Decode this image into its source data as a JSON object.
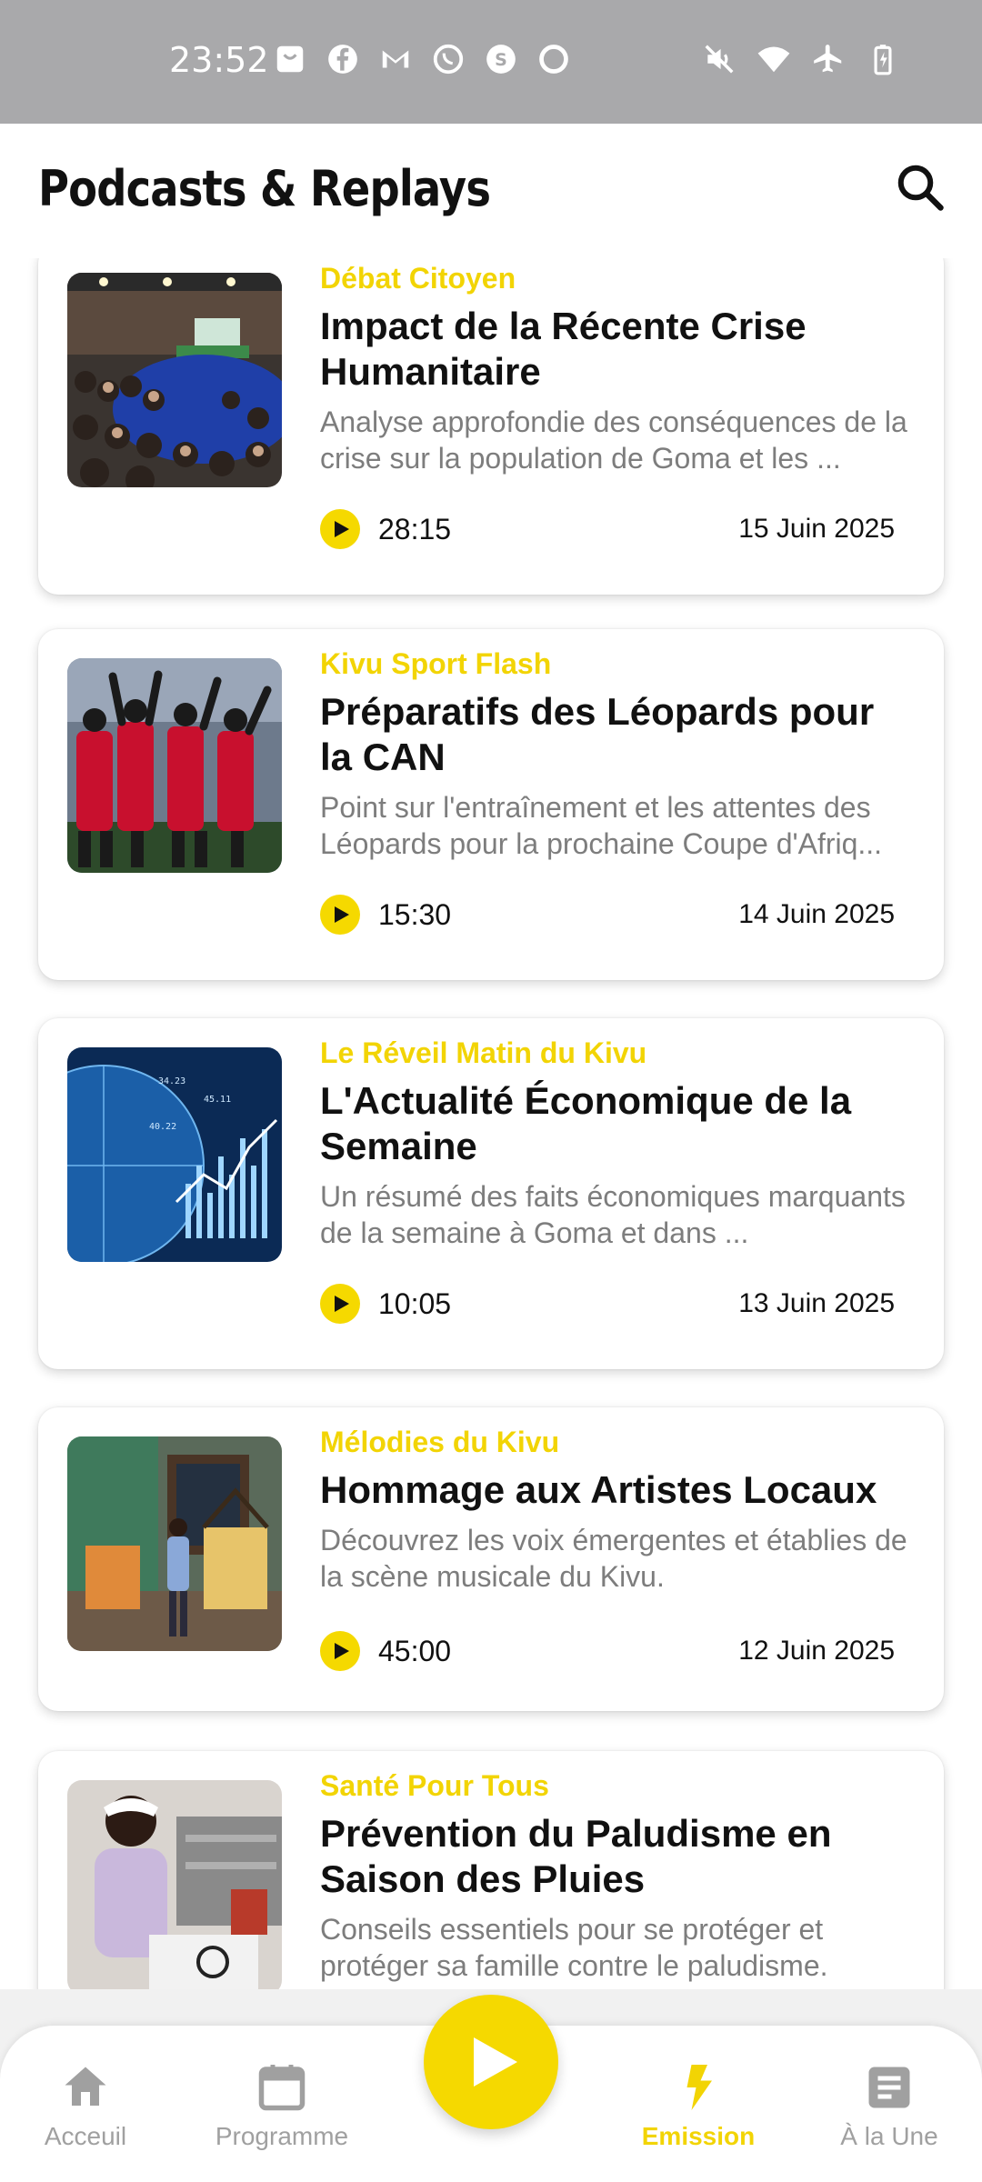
{
  "status_bar": {
    "time": "23:52",
    "left_icons": [
      "shopping-bag-icon",
      "facebook-icon",
      "gmail-icon",
      "whatsapp-icon",
      "shazam-icon",
      "circle-app-icon"
    ],
    "right_icons": [
      "mute-icon",
      "wifi-icon",
      "airplane-icon",
      "battery-charging-icon"
    ]
  },
  "header": {
    "title": "Podcasts & Replays",
    "search_icon": "search-icon"
  },
  "episodes": [
    {
      "category": "Débat Citoyen",
      "title": "Impact de la Récente Crise Humanitaire",
      "description": "Analyse approfondie des conséquences de la crise sur la population de Goma et les ...",
      "duration": "28:15",
      "date": "15 Juin 2025"
    },
    {
      "category": "Kivu Sport Flash",
      "title": "Préparatifs des Léopards pour la CAN",
      "description": "Point sur l'entraînement et les attentes des Léopards pour la prochaine Coupe d'Afriq...",
      "duration": "15:30",
      "date": "14 Juin 2025"
    },
    {
      "category": "Le Réveil Matin du Kivu",
      "title": "L'Actualité Économique de la Semaine",
      "description": "Un résumé des faits économiques marquants de la semaine à Goma et dans ...",
      "duration": "10:05",
      "date": "13 Juin 2025"
    },
    {
      "category": "Mélodies du Kivu",
      "title": "Hommage aux Artistes Locaux",
      "description": "Découvrez les voix émergentes et établies de la scène musicale du Kivu.",
      "duration": "45:00",
      "date": "12 Juin 2025"
    },
    {
      "category": "Santé Pour Tous",
      "title": "Prévention du Paludisme en Saison des Pluies",
      "description": "Conseils essentiels pour se protéger et protéger sa famille contre le paludisme.",
      "duration": "",
      "date": ""
    }
  ],
  "bottom_nav": {
    "items": [
      {
        "label": "Acceuil",
        "icon": "home-icon"
      },
      {
        "label": "Programme",
        "icon": "calendar-icon"
      },
      {
        "label": "Emission",
        "icon": "lightning-icon",
        "active": true
      },
      {
        "label": "À la Une",
        "icon": "article-icon"
      }
    ],
    "center_button_icon": "play-icon"
  },
  "colors": {
    "accent": "#f5d900",
    "category_text": "#f2d404",
    "status_bar": "#a9a9ab",
    "inactive_nav": "#a0a0a0"
  }
}
